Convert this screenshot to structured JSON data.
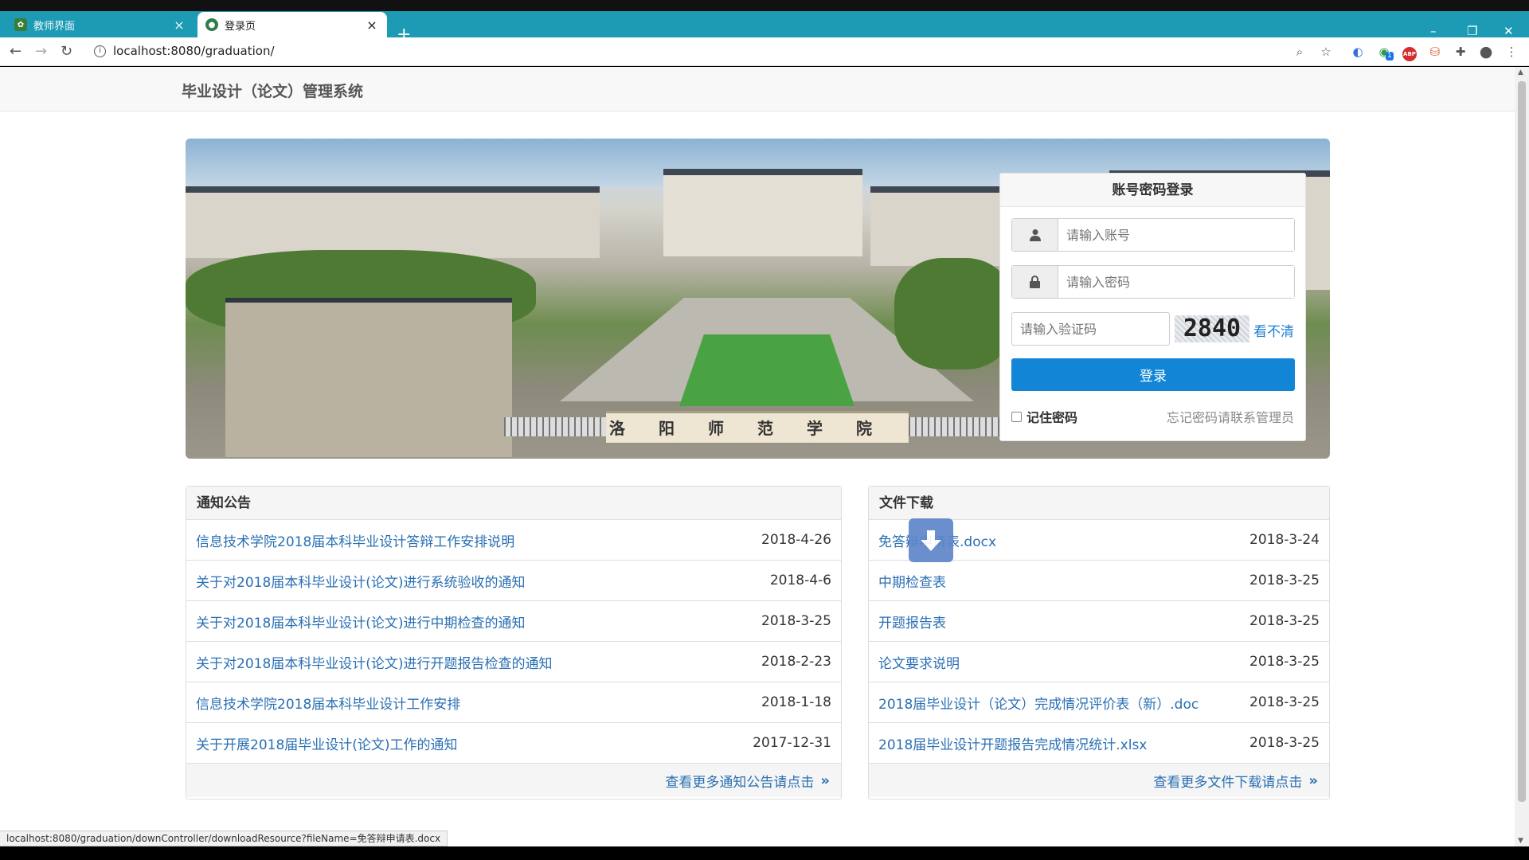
{
  "browser": {
    "tabs": [
      {
        "title": "教师界面",
        "close": "×"
      },
      {
        "title": "登录页",
        "close": "×"
      }
    ],
    "new_tab": "+",
    "window_controls": {
      "minimize": "–",
      "restore": "❐",
      "close": "✕"
    },
    "address": "localhost:8080/graduation/",
    "toolbar_icons": [
      "zoom-icon",
      "bookmark-star-icon",
      "extension-icon",
      "extension-badge-icon",
      "adblock-icon",
      "extension-icon",
      "puzzle-icon",
      "profile-icon",
      "menu-icon"
    ],
    "extension_badge": "1",
    "adblock_label": "ABP",
    "status_url": "localhost:8080/graduation/downController/downloadResource?fileName=免答辩申请表.docx"
  },
  "site": {
    "title": "毕业设计（论文）管理系统",
    "banner_sign": "洛阳师范学院"
  },
  "login": {
    "title": "账号密码登录",
    "account_placeholder": "请输入账号",
    "password_placeholder": "请输入密码",
    "captcha_placeholder": "请输入验证码",
    "captcha_code": "2840",
    "captcha_refresh": "看不清",
    "submit": "登录",
    "remember": "记住密码",
    "forgot": "忘记密码请联系管理员"
  },
  "notices": {
    "title": "通知公告",
    "items": [
      {
        "text": "信息技术学院2018届本科毕业设计答辩工作安排说明",
        "date": "2018-4-26"
      },
      {
        "text": "关于对2018届本科毕业设计(论文)进行系统验收的通知",
        "date": "2018-4-6"
      },
      {
        "text": "关于对2018届本科毕业设计(论文)进行中期检查的通知",
        "date": "2018-3-25"
      },
      {
        "text": "关于对2018届本科毕业设计(论文)进行开题报告检查的通知",
        "date": "2018-2-23"
      },
      {
        "text": "信息技术学院2018届本科毕业设计工作安排",
        "date": "2018-1-18"
      },
      {
        "text": "关于开展2018届毕业设计(论文)工作的通知",
        "date": "2017-12-31"
      }
    ],
    "more": "查看更多通知公告请点击"
  },
  "downloads": {
    "title": "文件下载",
    "items": [
      {
        "text": "免答辩申请表.docx",
        "date": "2018-3-24"
      },
      {
        "text": "中期检查表",
        "date": "2018-3-25"
      },
      {
        "text": "开题报告表",
        "date": "2018-3-25"
      },
      {
        "text": "论文要求说明",
        "date": "2018-3-25"
      },
      {
        "text": "2018届毕业设计（论文）完成情况评价表（新）.doc",
        "date": "2018-3-25"
      },
      {
        "text": "2018届毕业设计开题报告完成情况统计.xlsx",
        "date": "2018-3-25"
      }
    ],
    "more": "查看更多文件下载请点击"
  },
  "colors": {
    "tabstrip": "#1d9bb5",
    "primary_button": "#1385d7",
    "link": "#2a6fb3"
  }
}
